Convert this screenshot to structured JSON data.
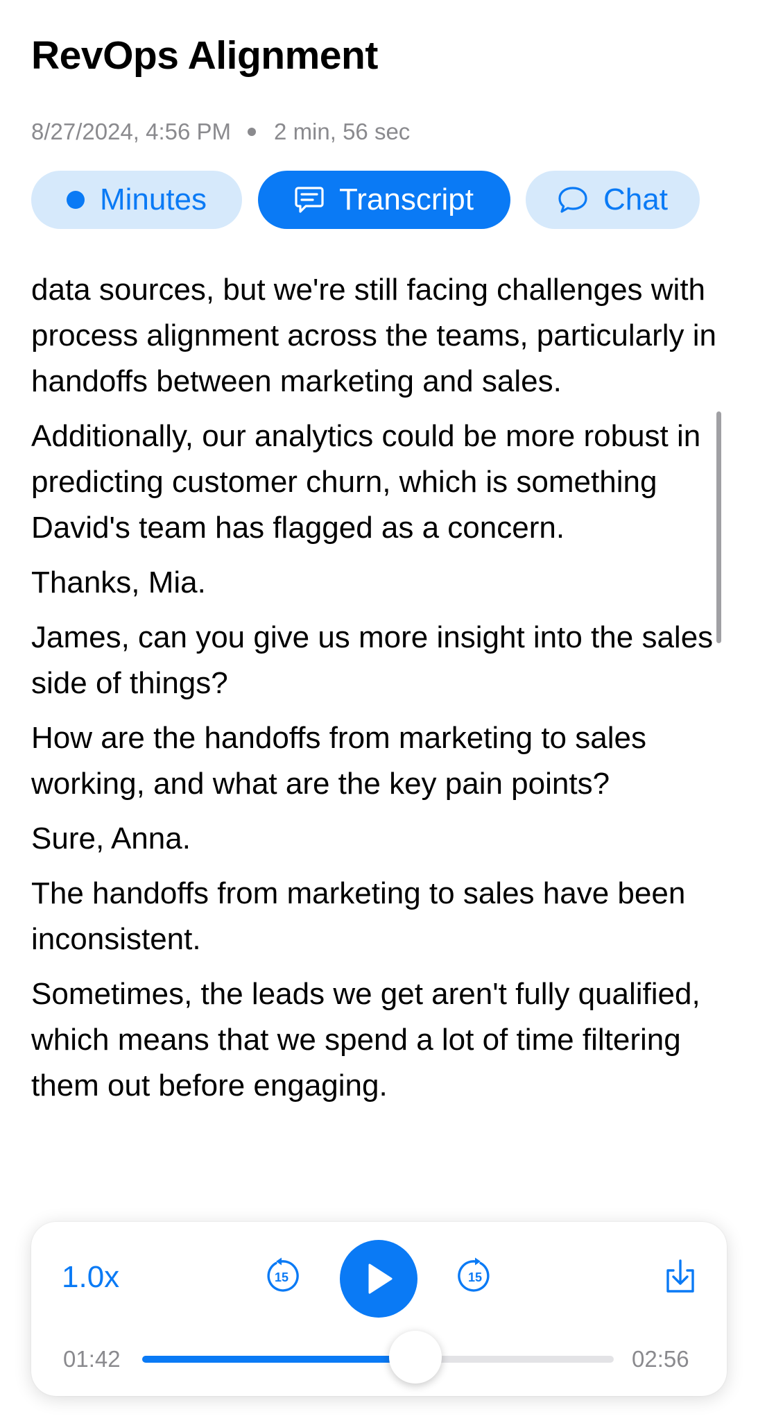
{
  "header": {
    "title": "RevOps Alignment",
    "date": "8/27/2024, 4:56 PM",
    "duration": "2 min, 56 sec"
  },
  "tabs": [
    {
      "label": "Minutes",
      "icon": "dot-icon",
      "active": false
    },
    {
      "label": "Transcript",
      "icon": "transcript-icon",
      "active": true
    },
    {
      "label": "Chat",
      "icon": "chat-bubble-icon",
      "active": false
    }
  ],
  "transcript": {
    "paragraphs": [
      "data sources, but we're still facing challenges with process alignment across the teams, particularly in handoffs between marketing and sales.",
      "Additionally, our analytics could be more robust in predicting customer churn, which is something David's team has flagged as a concern.",
      "Thanks, Mia.",
      "James, can you give us more insight into the sales side of things?",
      "How are the handoffs from marketing to sales working, and what are the key pain points?",
      "Sure, Anna.",
      "The handoffs from marketing to sales have been inconsistent.",
      "Sometimes, the leads we get aren't fully qualified, which means that we spend a lot of time filtering them out before engaging."
    ]
  },
  "player": {
    "speed": "1.0x",
    "skip_back_seconds": "15",
    "skip_forward_seconds": "15",
    "elapsed": "01:42",
    "total": "02:56",
    "progress_fraction": 0.58
  },
  "colors": {
    "accent": "#0a7af5",
    "tab_inactive_bg": "#d6e9fb",
    "secondary_text": "#8a8a8e"
  }
}
